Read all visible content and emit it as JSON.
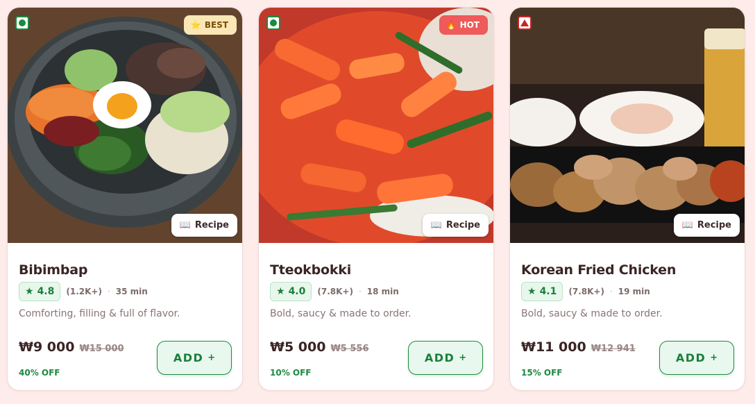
{
  "cards": [
    {
      "type": "veg",
      "tag": {
        "style": "best",
        "icon": "⭐",
        "label": "BEST"
      },
      "recipe_icon": "📖",
      "recipe_label": "Recipe",
      "title": "Bibimbap",
      "rating": "4.8",
      "rating_star": "★",
      "reviews": "(1.2K+)",
      "separator": "·",
      "time": "35 min",
      "description": "Comforting, filling & full of flavor.",
      "price": "₩9 000",
      "old_price": "₩15 000",
      "discount": "40% OFF",
      "add_label": "ADD",
      "add_plus": "+"
    },
    {
      "type": "veg",
      "tag": {
        "style": "hot",
        "icon": "🔥",
        "label": "HOT"
      },
      "recipe_icon": "📖",
      "recipe_label": "Recipe",
      "title": "Tteokbokki",
      "rating": "4.0",
      "rating_star": "★",
      "reviews": "(7.8K+)",
      "separator": "·",
      "time": "18 min",
      "description": "Bold, saucy & made to order.",
      "price": "₩5 000",
      "old_price": "₩5 556",
      "discount": "10% OFF",
      "add_label": "ADD",
      "add_plus": "+"
    },
    {
      "type": "non-veg",
      "tag": null,
      "recipe_icon": "📖",
      "recipe_label": "Recipe",
      "title": "Korean Fried Chicken",
      "rating": "4.1",
      "rating_star": "★",
      "reviews": "(7.8K+)",
      "separator": "·",
      "time": "19 min",
      "description": "Bold, saucy & made to order.",
      "price": "₩11 000",
      "old_price": "₩12 941",
      "discount": "15% OFF",
      "add_label": "ADD",
      "add_plus": "+"
    }
  ],
  "colors": {
    "page_background": "#fdecea",
    "accent_green": "#1b8a3e",
    "best_badge": "#fbe6b6",
    "hot_badge": "#ef5a5a",
    "non_veg_red": "#c62828"
  }
}
